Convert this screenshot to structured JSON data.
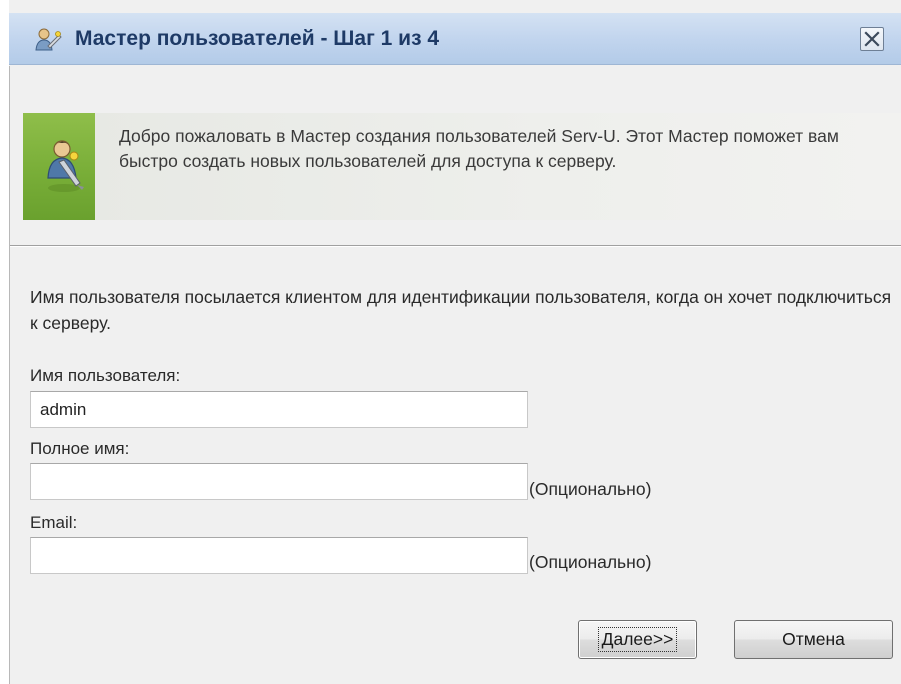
{
  "window": {
    "title": "Мастер пользователей - Шаг 1 из 4",
    "icons": [
      "users-wizard-icon",
      "close-icon"
    ]
  },
  "banner": {
    "text": "Добро пожаловать в Мастер создания пользователей Serv-U. Этот Мастер поможет вам быстро создать новых пользователей для доступа к серверу.",
    "icon": "user-wizard-icon",
    "accent_color": "#79ae38"
  },
  "form": {
    "description": "Имя пользователя посылается клиентом для идентификации пользователя, когда он хочет подключиться к серверу.",
    "username": {
      "label": "Имя пользователя:",
      "value": "admin"
    },
    "fullname": {
      "label": "Полное имя:",
      "value": "",
      "hint": "(Опционально)"
    },
    "email": {
      "label": "Email:",
      "value": "",
      "hint": "(Опционально)"
    }
  },
  "buttons": {
    "next": "Далее>>",
    "cancel": "Отмена"
  }
}
